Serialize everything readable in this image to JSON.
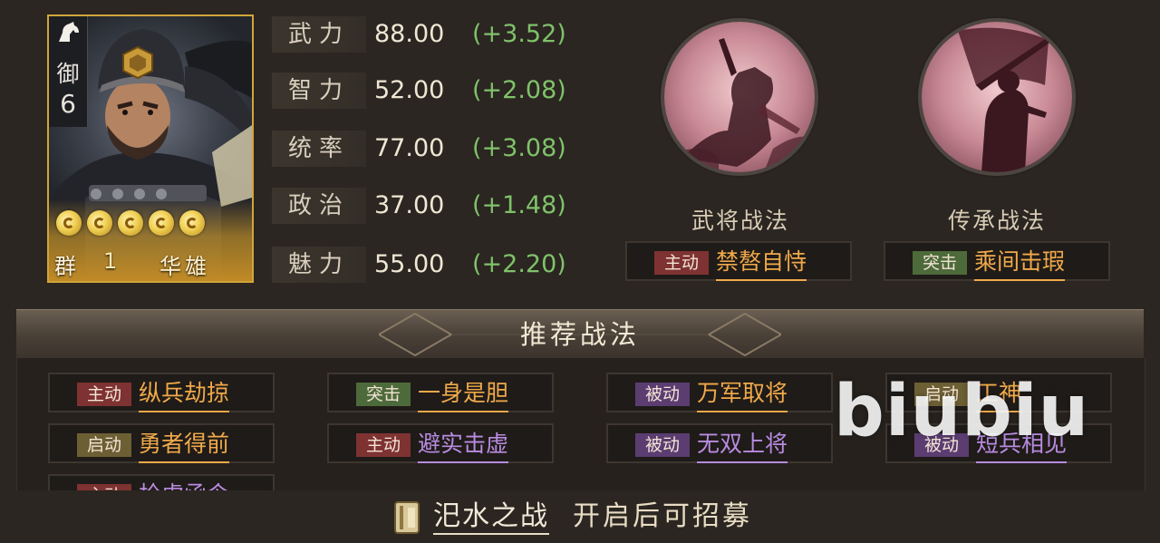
{
  "hero": {
    "side_char": "御",
    "side_num": "6",
    "faction": "群",
    "level": "1",
    "name": "华雄",
    "stars": 5
  },
  "stats": [
    {
      "label": "武力",
      "value": "88.00",
      "bonus": "(+3.52)"
    },
    {
      "label": "智力",
      "value": "52.00",
      "bonus": "(+2.08)"
    },
    {
      "label": "统率",
      "value": "77.00",
      "bonus": "(+3.08)"
    },
    {
      "label": "政治",
      "value": "37.00",
      "bonus": "(+1.48)"
    },
    {
      "label": "魅力",
      "value": "55.00",
      "bonus": "(+2.20)"
    }
  ],
  "skills": {
    "hero_skill": {
      "caption": "武将战法",
      "tag": "主动",
      "name": "禁嗸自恃"
    },
    "inherit_skill": {
      "caption": "传承战法",
      "tag": "突击",
      "name": "乘间击瑕"
    }
  },
  "recommended": {
    "title": "推荐战法",
    "items": [
      {
        "tag": "主动",
        "name": "纵兵劫掠"
      },
      {
        "tag": "突击",
        "name": "一身是胆"
      },
      {
        "tag": "被动",
        "name": "万军取将"
      },
      {
        "tag": "启动",
        "name": "工神"
      },
      {
        "tag": "启动",
        "name": "勇者得前"
      },
      {
        "tag": "主动",
        "name": "避实击虚"
      },
      {
        "tag": "被动",
        "name": "无双上将"
      },
      {
        "tag": "被动",
        "name": "短兵相见"
      },
      {
        "tag": "主动",
        "name": "枪虎函令"
      }
    ]
  },
  "footer": {
    "battle": "汜水之战",
    "note": "开启后可招募"
  },
  "watermark": "biubiu",
  "colors": {
    "bonus_green": "#7fc26a",
    "gold_name": "#f0a94a",
    "purple_name": "#b88be0",
    "card_border": "#d1a53a"
  }
}
